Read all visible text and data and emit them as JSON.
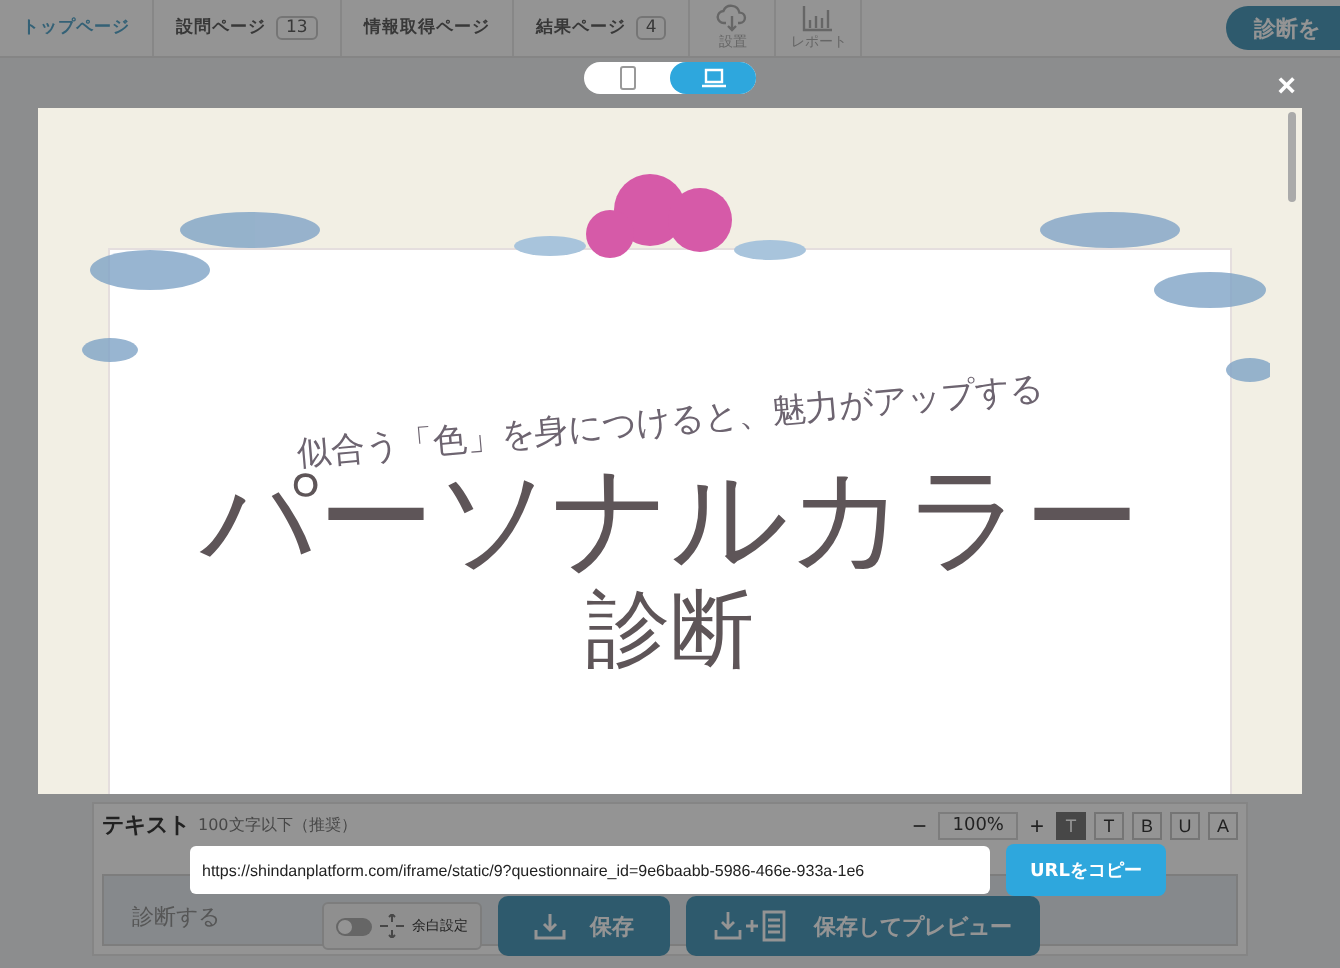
{
  "nav": {
    "tabs": [
      {
        "label": "トップページ",
        "selected": true
      },
      {
        "label": "設問ページ",
        "count": "13",
        "selected": false
      },
      {
        "label": "情報取得ページ",
        "selected": false
      },
      {
        "label": "結果ページ",
        "count": "4",
        "selected": false
      }
    ],
    "tools": [
      {
        "kind": "cloud",
        "label": "設置"
      },
      {
        "kind": "chart",
        "label": "レポート"
      }
    ],
    "action": "診断を"
  },
  "editor": {
    "label": "テキスト",
    "hint": "100文字以下（推奨）",
    "minus": "−",
    "zoom": "100%",
    "plus": "+",
    "format_buttons": [
      {
        "label": "T",
        "selected": true
      },
      {
        "label": "T",
        "selected": false
      },
      {
        "label": "B",
        "selected": false
      },
      {
        "label": "U",
        "selected": false
      },
      {
        "label": "A",
        "selected": false
      }
    ],
    "placeholder": "診断する",
    "margin_toggle": {
      "label": "余白設定",
      "on": false
    },
    "save": "保存",
    "save_preview": "保存してプレビュー"
  },
  "modal": {
    "close": "×",
    "devices": [
      {
        "kind": "phone",
        "selected": false
      },
      {
        "kind": "laptop",
        "selected": true
      }
    ],
    "preview": {
      "subtitle": "似合う「色」を身につけると、魅力がアップする",
      "title": "パーソナルカラー",
      "title_2": "診断"
    },
    "url": "https://shindanplatform.com/iframe/static/9?questionnaire_id=9e6baabb-5986-466e-933a-1e6",
    "copy_button": "URLをコピー"
  }
}
